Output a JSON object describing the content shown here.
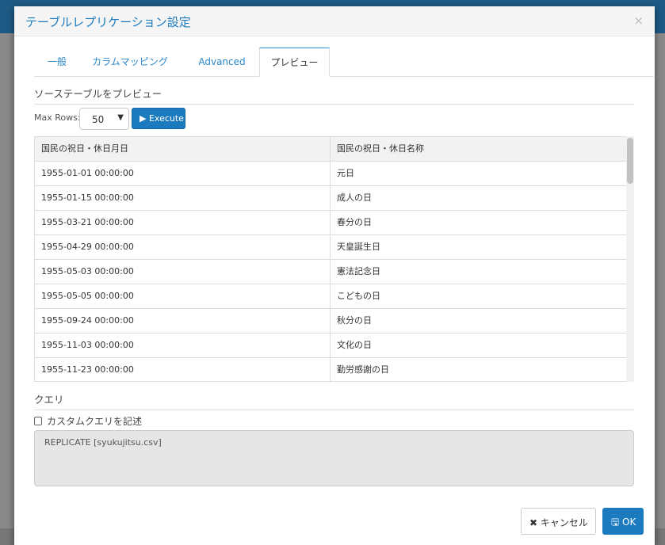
{
  "dialog": {
    "title": "テーブルレプリケーション設定",
    "close": "×"
  },
  "tabs": [
    {
      "label": "一般"
    },
    {
      "label": "カラムマッピング"
    },
    {
      "label": "Advanced"
    },
    {
      "label": "プレビュー"
    }
  ],
  "preview": {
    "heading": "ソーステーブルをプレビュー",
    "max_rows_label": "Max Rows:",
    "max_rows_value": "50",
    "execute_label": "▶ Execute"
  },
  "table": {
    "headers": [
      "国民の祝日・休日月日",
      "国民の祝日・休日名称"
    ],
    "rows": [
      [
        "1955-01-01 00:00:00",
        "元日"
      ],
      [
        "1955-01-15 00:00:00",
        "成人の日"
      ],
      [
        "1955-03-21 00:00:00",
        "春分の日"
      ],
      [
        "1955-04-29 00:00:00",
        "天皇誕生日"
      ],
      [
        "1955-05-03 00:00:00",
        "憲法記念日"
      ],
      [
        "1955-05-05 00:00:00",
        "こどもの日"
      ],
      [
        "1955-09-24 00:00:00",
        "秋分の日"
      ],
      [
        "1955-11-03 00:00:00",
        "文化の日"
      ],
      [
        "1955-11-23 00:00:00",
        "勤労感謝の日"
      ]
    ]
  },
  "query": {
    "heading": "クエリ",
    "custom_label": "カスタムクエリを記述",
    "custom_checked": false,
    "text": "REPLICATE [syukujitsu.csv]"
  },
  "footer": {
    "cancel": "✖ キャンセル",
    "ok": "🖫 OK"
  },
  "colors": {
    "accent": "#1c7bbf"
  }
}
